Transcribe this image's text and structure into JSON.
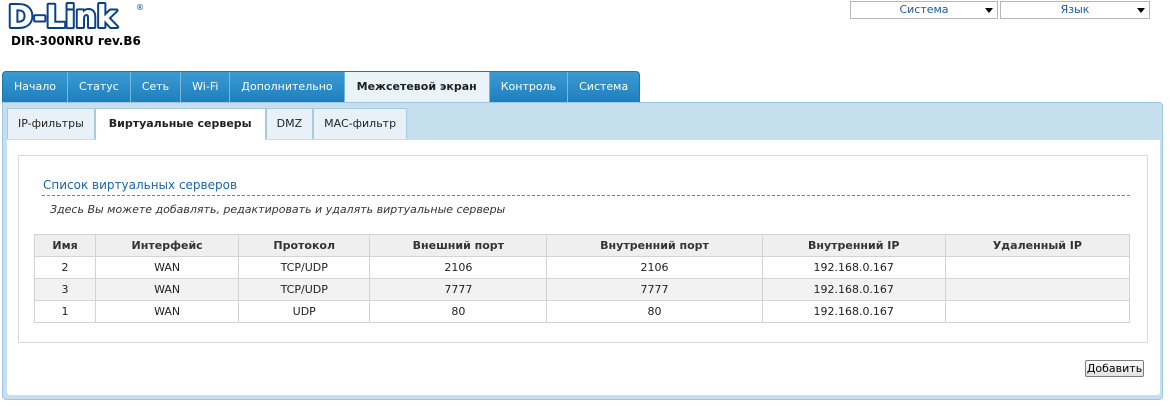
{
  "header": {
    "model": "DIR-300NRU rev.B6",
    "system_select": "Система",
    "language_select": "Язык"
  },
  "main_tabs": [
    {
      "label": "Начало",
      "active": false
    },
    {
      "label": "Статус",
      "active": false
    },
    {
      "label": "Сеть",
      "active": false
    },
    {
      "label": "Wi-Fi",
      "active": false
    },
    {
      "label": "Дополнительно",
      "active": false
    },
    {
      "label": "Межсетевой экран",
      "active": true
    },
    {
      "label": "Контроль",
      "active": false
    },
    {
      "label": "Система",
      "active": false
    }
  ],
  "sub_tabs": [
    {
      "label": "IP-фильтры",
      "active": false
    },
    {
      "label": "Виртуальные серверы",
      "active": true
    },
    {
      "label": "DMZ",
      "active": false
    },
    {
      "label": "MAC-фильтр",
      "active": false
    }
  ],
  "section": {
    "title": "Список виртуальных серверов",
    "description": "Здесь Вы можете добавлять, редактировать и удалять виртуальные серверы"
  },
  "table": {
    "columns": [
      "Имя",
      "Интерфейс",
      "Протокол",
      "Внешний порт",
      "Внутренний порт",
      "Внутренний IP",
      "Удаленный IP"
    ],
    "rows": [
      [
        "2",
        "WAN",
        "TCP/UDP",
        "2106",
        "2106",
        "192.168.0.167",
        ""
      ],
      [
        "3",
        "WAN",
        "TCP/UDP",
        "7777",
        "7777",
        "192.168.0.167",
        ""
      ],
      [
        "1",
        "WAN",
        "UDP",
        "80",
        "80",
        "192.168.0.167",
        ""
      ]
    ]
  },
  "buttons": {
    "add": "Добавить"
  },
  "colors": {
    "brand": "#1c5aa5",
    "tab_bar": "#2b8ec9",
    "panel": "#c6dfee"
  },
  "icons": {
    "logo": "d-link-logo",
    "dropdown": "chevron-down-icon"
  }
}
